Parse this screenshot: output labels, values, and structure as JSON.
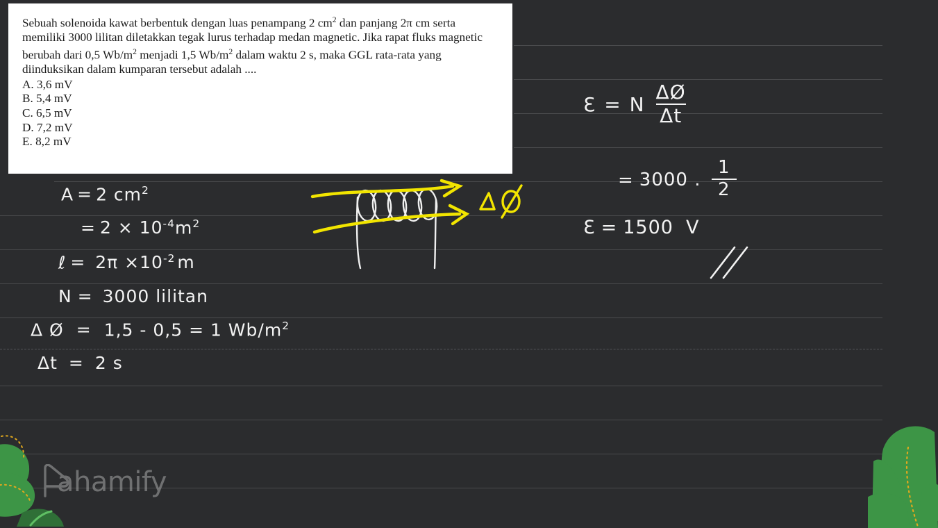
{
  "page": {
    "background_color": "#2b2c2e",
    "rule_line_color": "#4a4b4d",
    "handwriting_color": "#f3f3f3",
    "highlight_color": "#f2e500",
    "leaf_color": "#3d9546",
    "leaf_vein_color": "#e0a81e"
  },
  "question_card": {
    "background_color": "#ffffff",
    "paragraph_part1": "Sebuah solenoida kawat berbentuk dengan luas penampang 2 cm",
    "paragraph_sup1": "2",
    "paragraph_part2": " dan panjang 2π cm serta memiliki 3000 lilitan diletakkan tegak lurus terhadap medan magnetic. Jika rapat fluks magnetic berubah dari 0,5 Wb/m",
    "paragraph_sup2": "2",
    "paragraph_part3": " menjadi 1,5 Wb/m",
    "paragraph_sup3": "2",
    "paragraph_part4": " dalam waktu 2 s, maka GGL rata-rata yang diinduksikan dalam kumparan tersebut adalah ....",
    "choices": [
      "A. 3,6 mV",
      "B. 5,4 mV",
      "C. 6,5 mV",
      "D. 7,2 mV",
      "E. 8,2 mV"
    ]
  },
  "handwritten_left": {
    "line1_label": "A",
    "line1_eq": "=",
    "line1_value": "2 cm",
    "line1_sup": "2",
    "line2_eq": "=",
    "line2_value": "2 × 10",
    "line2_sup": "-4",
    "line2_unit": "m",
    "line2_unit_sup": "2",
    "line3_label": "ℓ",
    "line3_eq": "=",
    "line3_value": "2π ×10",
    "line3_sup": "-2",
    "line3_unit": "m",
    "line4_label": "N",
    "line4_eq": "=",
    "line4_value": "3000  lilitan",
    "line5_label": "Δ Ø",
    "line5_eq": "=",
    "line5_value": "1,5 - 0,5 = 1  Wb/m",
    "line5_sup": "2",
    "line6_label": "Δt",
    "line6_eq": "=",
    "line6_value": "2 s"
  },
  "handwritten_right": {
    "formula_symbol": "Ɛ",
    "formula_eq": "=",
    "formula_n": "N",
    "formula_num": "ΔØ",
    "formula_den": "Δt",
    "step_eq": "=",
    "step_value": "3000 .",
    "step_num": "1",
    "step_den": "2",
    "result_symbol": "Ɛ",
    "result_eq": "=",
    "result_value": "1500",
    "result_unit": "V"
  },
  "drawing": {
    "label_delta_phi": "ΔØ",
    "description": "solenoid-coil-with-flux-arrows"
  },
  "watermark": {
    "brand": "ahamify",
    "logo_icon": "pahamify-play-p-logo"
  }
}
